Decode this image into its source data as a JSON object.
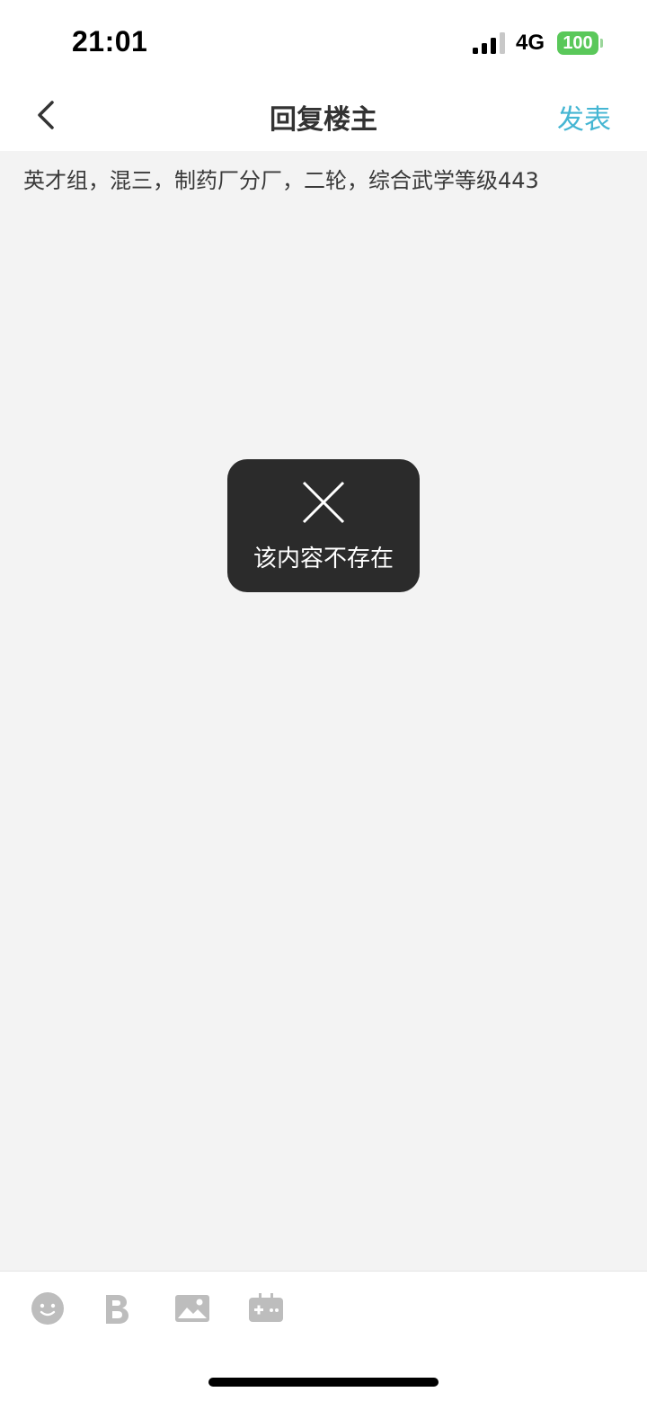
{
  "status_bar": {
    "time": "21:01",
    "network": "4G",
    "battery": "100"
  },
  "nav": {
    "back_icon": "chevron-left-icon",
    "title": "回复楼主",
    "publish_label": "发表",
    "publish_color": "#45b6d3"
  },
  "content": {
    "reply_text": "英才组，混三，制药厂分厂，二轮，综合武学等级443"
  },
  "toast": {
    "icon": "close-icon",
    "message": "该内容不存在"
  },
  "toolbar": {
    "items": [
      {
        "icon": "emoji-icon"
      },
      {
        "icon": "bold-icon"
      },
      {
        "icon": "image-icon"
      },
      {
        "icon": "game-icon"
      }
    ]
  },
  "colors": {
    "background": "#f3f3f3",
    "battery_green": "#5ac85a",
    "toolbar_icon": "#bdbdbd",
    "toast_background": "#2b2b2b"
  }
}
